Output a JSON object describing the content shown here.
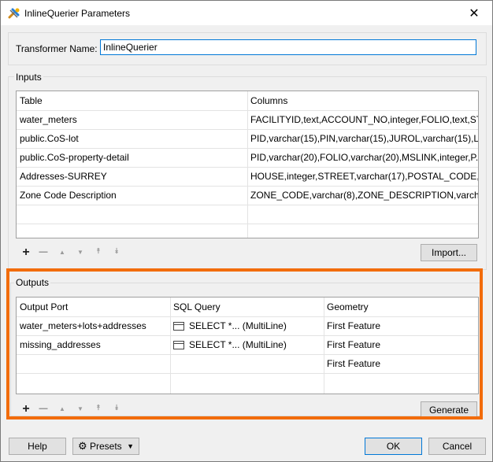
{
  "window": {
    "title": "InlineQuerier Parameters",
    "close_glyph": "✕"
  },
  "transformer": {
    "label": "Transformer Name:",
    "value": "InlineQuerier"
  },
  "inputs": {
    "group_label": "Inputs",
    "columns": [
      "Table",
      "Columns"
    ],
    "rows": [
      [
        "water_meters",
        "FACILITYID,text,ACCOUNT_NO,integer,FOLIO,text,ST..."
      ],
      [
        "public.CoS-lot",
        "PID,varchar(15),PIN,varchar(15),JUROL,varchar(15),L..."
      ],
      [
        "public.CoS-property-detail",
        "PID,varchar(20),FOLIO,varchar(20),MSLINK,integer,P..."
      ],
      [
        "Addresses-SURREY",
        "HOUSE,integer,STREET,varchar(17),POSTAL_CODE,v..."
      ],
      [
        "Zone Code Description",
        "ZONE_CODE,varchar(8),ZONE_DESCRIPTION,varcha..."
      ],
      [
        "",
        ""
      ]
    ],
    "import_label": "Import..."
  },
  "outputs": {
    "group_label": "Outputs",
    "columns": [
      "Output Port",
      "SQL Query",
      "Geometry"
    ],
    "rows": [
      [
        "water_meters+lots+addresses",
        "SELECT *... (MultiLine)",
        "First Feature"
      ],
      [
        "missing_addresses",
        "SELECT *... (MultiLine)",
        "First Feature"
      ],
      [
        "",
        "",
        "First Feature"
      ]
    ],
    "generate_label": "Generate"
  },
  "toolbar": {
    "add": "+",
    "remove": "—",
    "up": "▲",
    "down": "▼",
    "top": "⯭",
    "bottom": "⯯"
  },
  "footer": {
    "help": "Help",
    "presets": "Presets",
    "ok": "OK",
    "cancel": "Cancel"
  },
  "colors": {
    "highlight": "#f26c0b",
    "focus": "#0078d7"
  },
  "icons": {
    "title": "fme-transformer-icon",
    "presets": "gear-icon",
    "dropdown": "caret-down-icon"
  }
}
